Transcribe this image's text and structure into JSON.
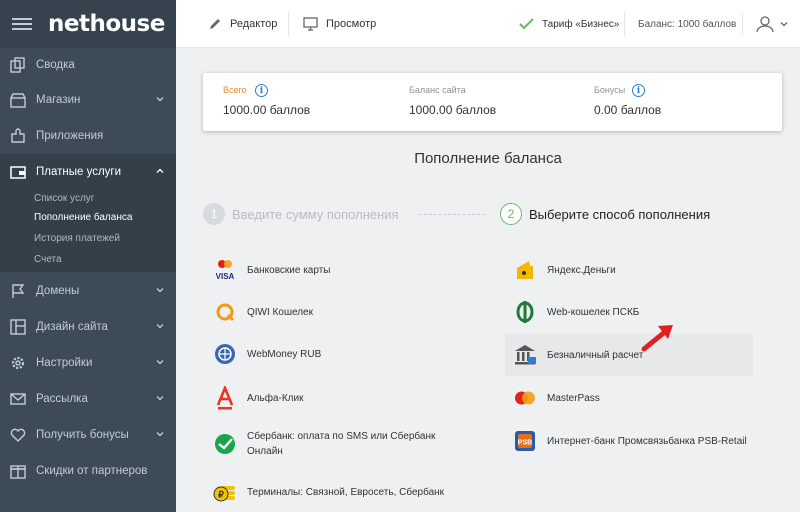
{
  "app": {
    "logo": "nethouse"
  },
  "sidebar": {
    "items": [
      {
        "label": "Сводка",
        "icon": "copy-icon"
      },
      {
        "label": "Магазин",
        "icon": "shop-icon"
      },
      {
        "label": "Приложения",
        "icon": "puzzle-icon"
      },
      {
        "label": "Платные услуги",
        "icon": "wallet-icon"
      },
      {
        "label": "Домены",
        "icon": "flag-icon"
      },
      {
        "label": "Дизайн сайта",
        "icon": "layout-icon"
      },
      {
        "label": "Настройки",
        "icon": "gear-icon"
      },
      {
        "label": "Рассылка",
        "icon": "envelope-icon"
      },
      {
        "label": "Получить бонусы",
        "icon": "heart-icon"
      },
      {
        "label": "Скидки от партнеров",
        "icon": "gift-icon"
      }
    ],
    "sub_items": [
      "Список услуг",
      "Пополнение баланса",
      "История платежей",
      "Счета"
    ]
  },
  "topbar": {
    "editor": "Редактор",
    "preview": "Просмотр",
    "tariff": "Тариф «Бизнес»",
    "balance_label": "Баланс:",
    "balance_value": "1000 баллов"
  },
  "summary": {
    "total_label": "Всего",
    "total_value": "1000.00 баллов",
    "site_label": "Баланс сайта",
    "site_value": "1000.00 баллов",
    "bonus_label": "Бонусы",
    "bonus_value": "0.00 баллов"
  },
  "page_title": "Пополнение баланса",
  "steps": [
    {
      "num": "1",
      "label": "Введите сумму пополнения"
    },
    {
      "num": "2",
      "label": "Выберите способ пополнения"
    }
  ],
  "methods_left": [
    "Банковские карты",
    "QIWI Кошелек",
    "WebMoney RUB",
    "Альфа-Клик",
    "Сбербанк: оплата по SMS или Сбербанк Онлайн",
    "Терминалы: Связной, Евросеть, Сбербанк"
  ],
  "methods_right": [
    "Яндекс.Деньги",
    "Web-кошелек ПСКБ",
    "Безналичный расчет",
    "MasterPass",
    "Интернет-банк Промсвязьбанка PSB-Retail"
  ],
  "card_icon_text": "VISA",
  "psb_icon_text": "PSB",
  "colors": {
    "accent_blue": "#2a7fd4",
    "accent_green": "#66b86b",
    "sidebar": "#3d4b57",
    "arrow_red": "#e02020"
  }
}
